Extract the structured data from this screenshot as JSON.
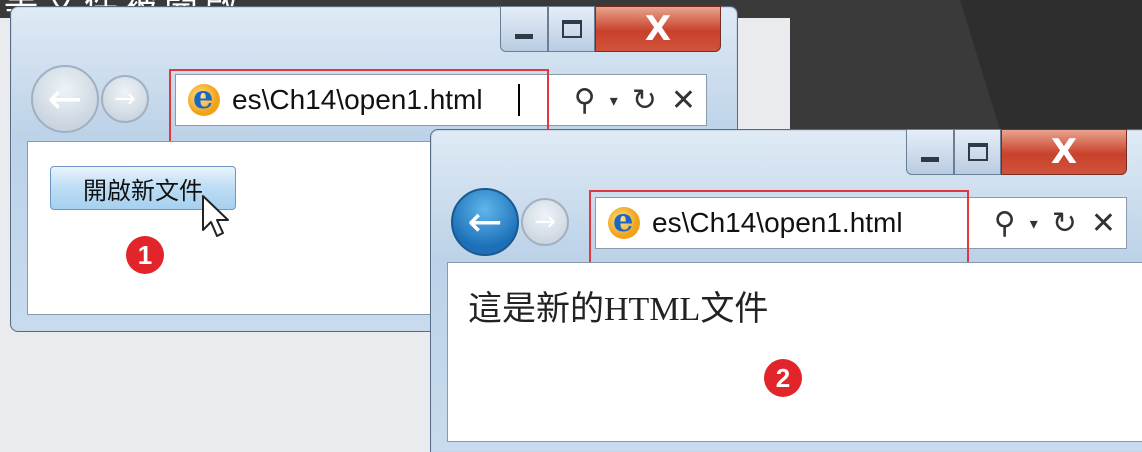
{
  "slide": {
    "caption": "等文件被開啟"
  },
  "window_controls": {
    "minimize_icon": "minimize-icon",
    "maximize_icon": "maximize-icon",
    "close_icon": "close-icon",
    "close_glyph": "X"
  },
  "window1": {
    "address": {
      "url": "es\\Ch14\\open1.html"
    },
    "button": {
      "label": "開啟新文件"
    },
    "badge": "1"
  },
  "window2": {
    "address": {
      "url": "es\\Ch14\\open1.html"
    },
    "content_text": "這是新的HTML文件",
    "badge": "2"
  },
  "colors": {
    "highlight_box": "#e0383d",
    "badge": "#e2252b",
    "close_button": "#c8412b",
    "back_button_active": "#1c6fb8"
  }
}
